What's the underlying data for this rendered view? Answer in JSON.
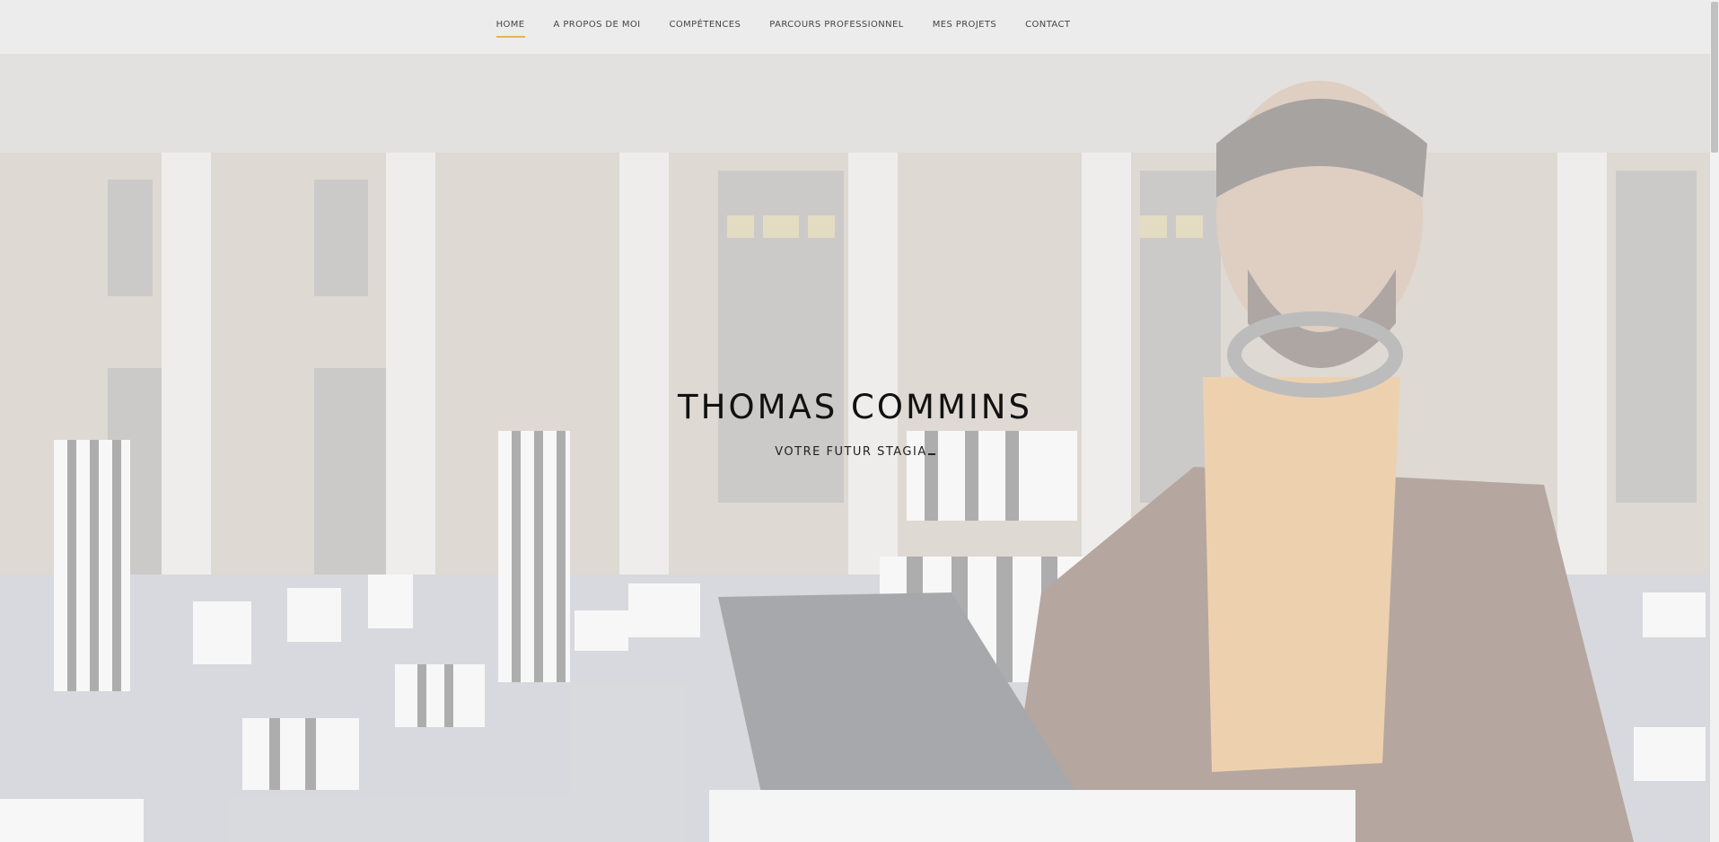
{
  "nav": {
    "items": [
      {
        "label": "HOME",
        "active": true
      },
      {
        "label": "A PROPOS DE MOI",
        "active": false
      },
      {
        "label": "COMPÉTENCES",
        "active": false
      },
      {
        "label": "PARCOURS PROFESSIONNEL",
        "active": false
      },
      {
        "label": "MES PROJETS",
        "active": false
      },
      {
        "label": "CONTACT",
        "active": false
      }
    ]
  },
  "hero": {
    "name": "THOMAS COMMINS",
    "tagline": "VOTRE FUTUR STAGIA"
  },
  "colors": {
    "accent": "#e6b25a",
    "text": "#111111"
  }
}
